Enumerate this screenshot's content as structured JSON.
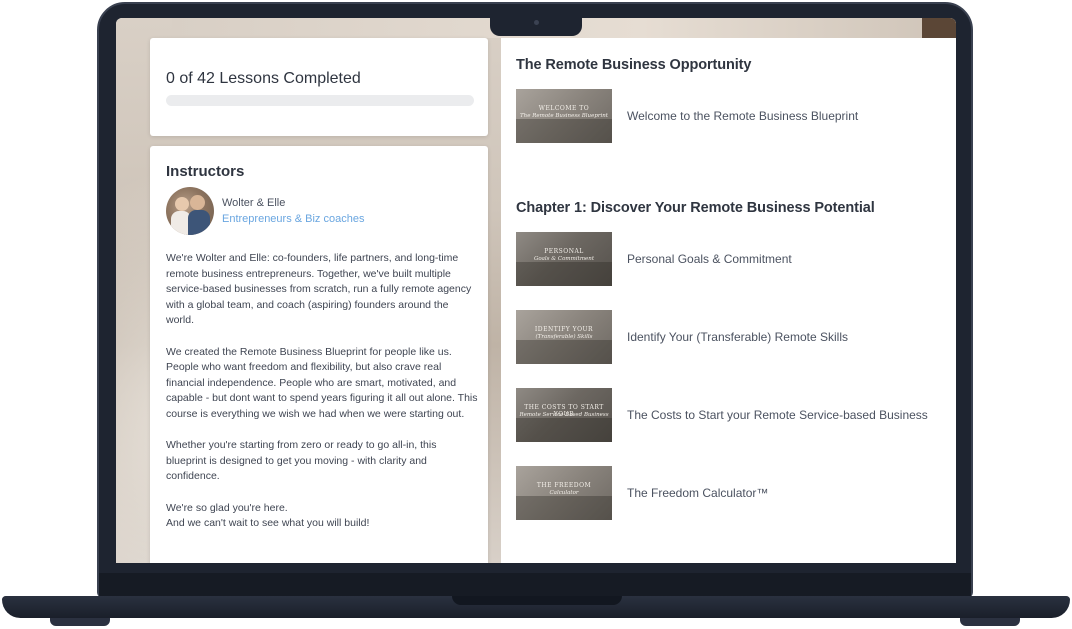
{
  "progress": {
    "title": "0 of 42 Lessons Completed",
    "completed": 0,
    "total": 42,
    "bar_fill_fraction": 0,
    "bar_color": "#6aa6e0",
    "track_color": "#ebecee"
  },
  "instructors": {
    "heading": "Instructors",
    "name": "Wolter & Elle",
    "role": "Entrepreneurs & Biz coaches",
    "bio": [
      "We're Wolter and Elle: co-founders, life partners, and long-time remote business entrepreneurs. Together, we've built multiple service-based businesses from scratch, run a fully remote agency with a global team, and coach (aspiring) founders around the world.",
      "We created the Remote Business Blueprint for people like us. People who want freedom and flexibility, but also crave real financial independence. People who are smart, motivated, and capable - but dont want to spend years figuring it all out alone. This course is everything we wish we had when we were starting out.",
      "Whether you're starting from zero or ready to go all-in, this blueprint is designed to get you moving - with clarity and confidence.",
      "We're so glad you're here.",
      "And we can't wait to see what you will build!"
    ]
  },
  "sections": [
    {
      "title": "The Remote Business Opportunity",
      "lessons": [
        {
          "title": "Welcome to the Remote Business Blueprint",
          "thumb_line1": "WELCOME TO",
          "thumb_line2": "The Remote Business Blueprint"
        }
      ]
    },
    {
      "title": "Chapter 1: Discover Your Remote Business Potential",
      "lessons": [
        {
          "title": "Personal Goals & Commitment",
          "thumb_line1": "PERSONAL",
          "thumb_line2": "Goals & Commitment"
        },
        {
          "title": "Identify Your (Transferable) Remote Skills",
          "thumb_line1": "IDENTIFY YOUR",
          "thumb_line2": "(Transferable) Skills"
        },
        {
          "title": "The Costs to Start your Remote Service-based Business",
          "thumb_line1": "THE COSTS TO START YOUR",
          "thumb_line2": "Remote Service-Based Business"
        },
        {
          "title": "The Freedom Calculator™",
          "thumb_line1": "THE FREEDOM",
          "thumb_line2": "Calculator"
        }
      ]
    }
  ]
}
